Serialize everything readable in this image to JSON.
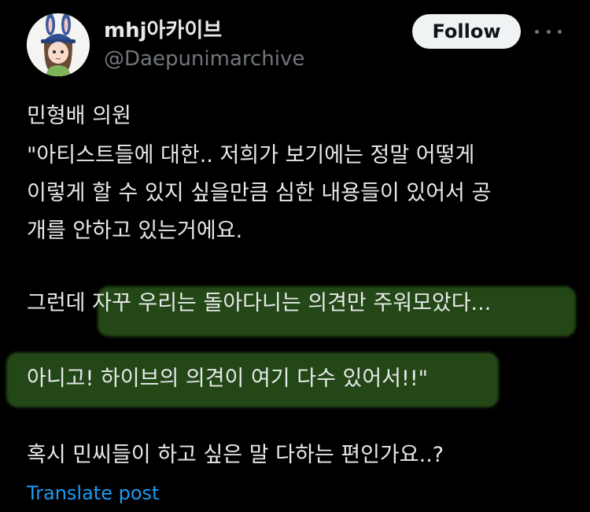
{
  "author": {
    "display_name": "mhj아카이브",
    "handle": "@Daepunimarchive"
  },
  "header": {
    "follow_label": "Follow"
  },
  "post": {
    "lines": [
      "민형배 의원",
      " \"아티스트들에 대한.. 저희가 보기에는 정말 어떻게",
      "이렇게 할 수 있지 싶을만큼 심한 내용들이 있어서 공",
      "개를 안하고 있는거에요."
    ],
    "line5_prefix": "그런데 ",
    "line5_highlight": "자꾸 우리는 돌아다니는 의견만 주워모았다...",
    "line6": "아니고! 하이브의 의견이 여기 다수 있어서!!\"",
    "line7": "혹시 민씨들이 하고 싶은 말 다하는 편인가요..?"
  },
  "actions": {
    "translate_label": "Translate post"
  },
  "colors": {
    "background": "#000000",
    "text": "#e7e9ea",
    "muted": "#71767b",
    "link": "#1d9bf0",
    "highlight": "#3f7f27"
  },
  "icons": {
    "more": "more-horizontal-icon"
  }
}
